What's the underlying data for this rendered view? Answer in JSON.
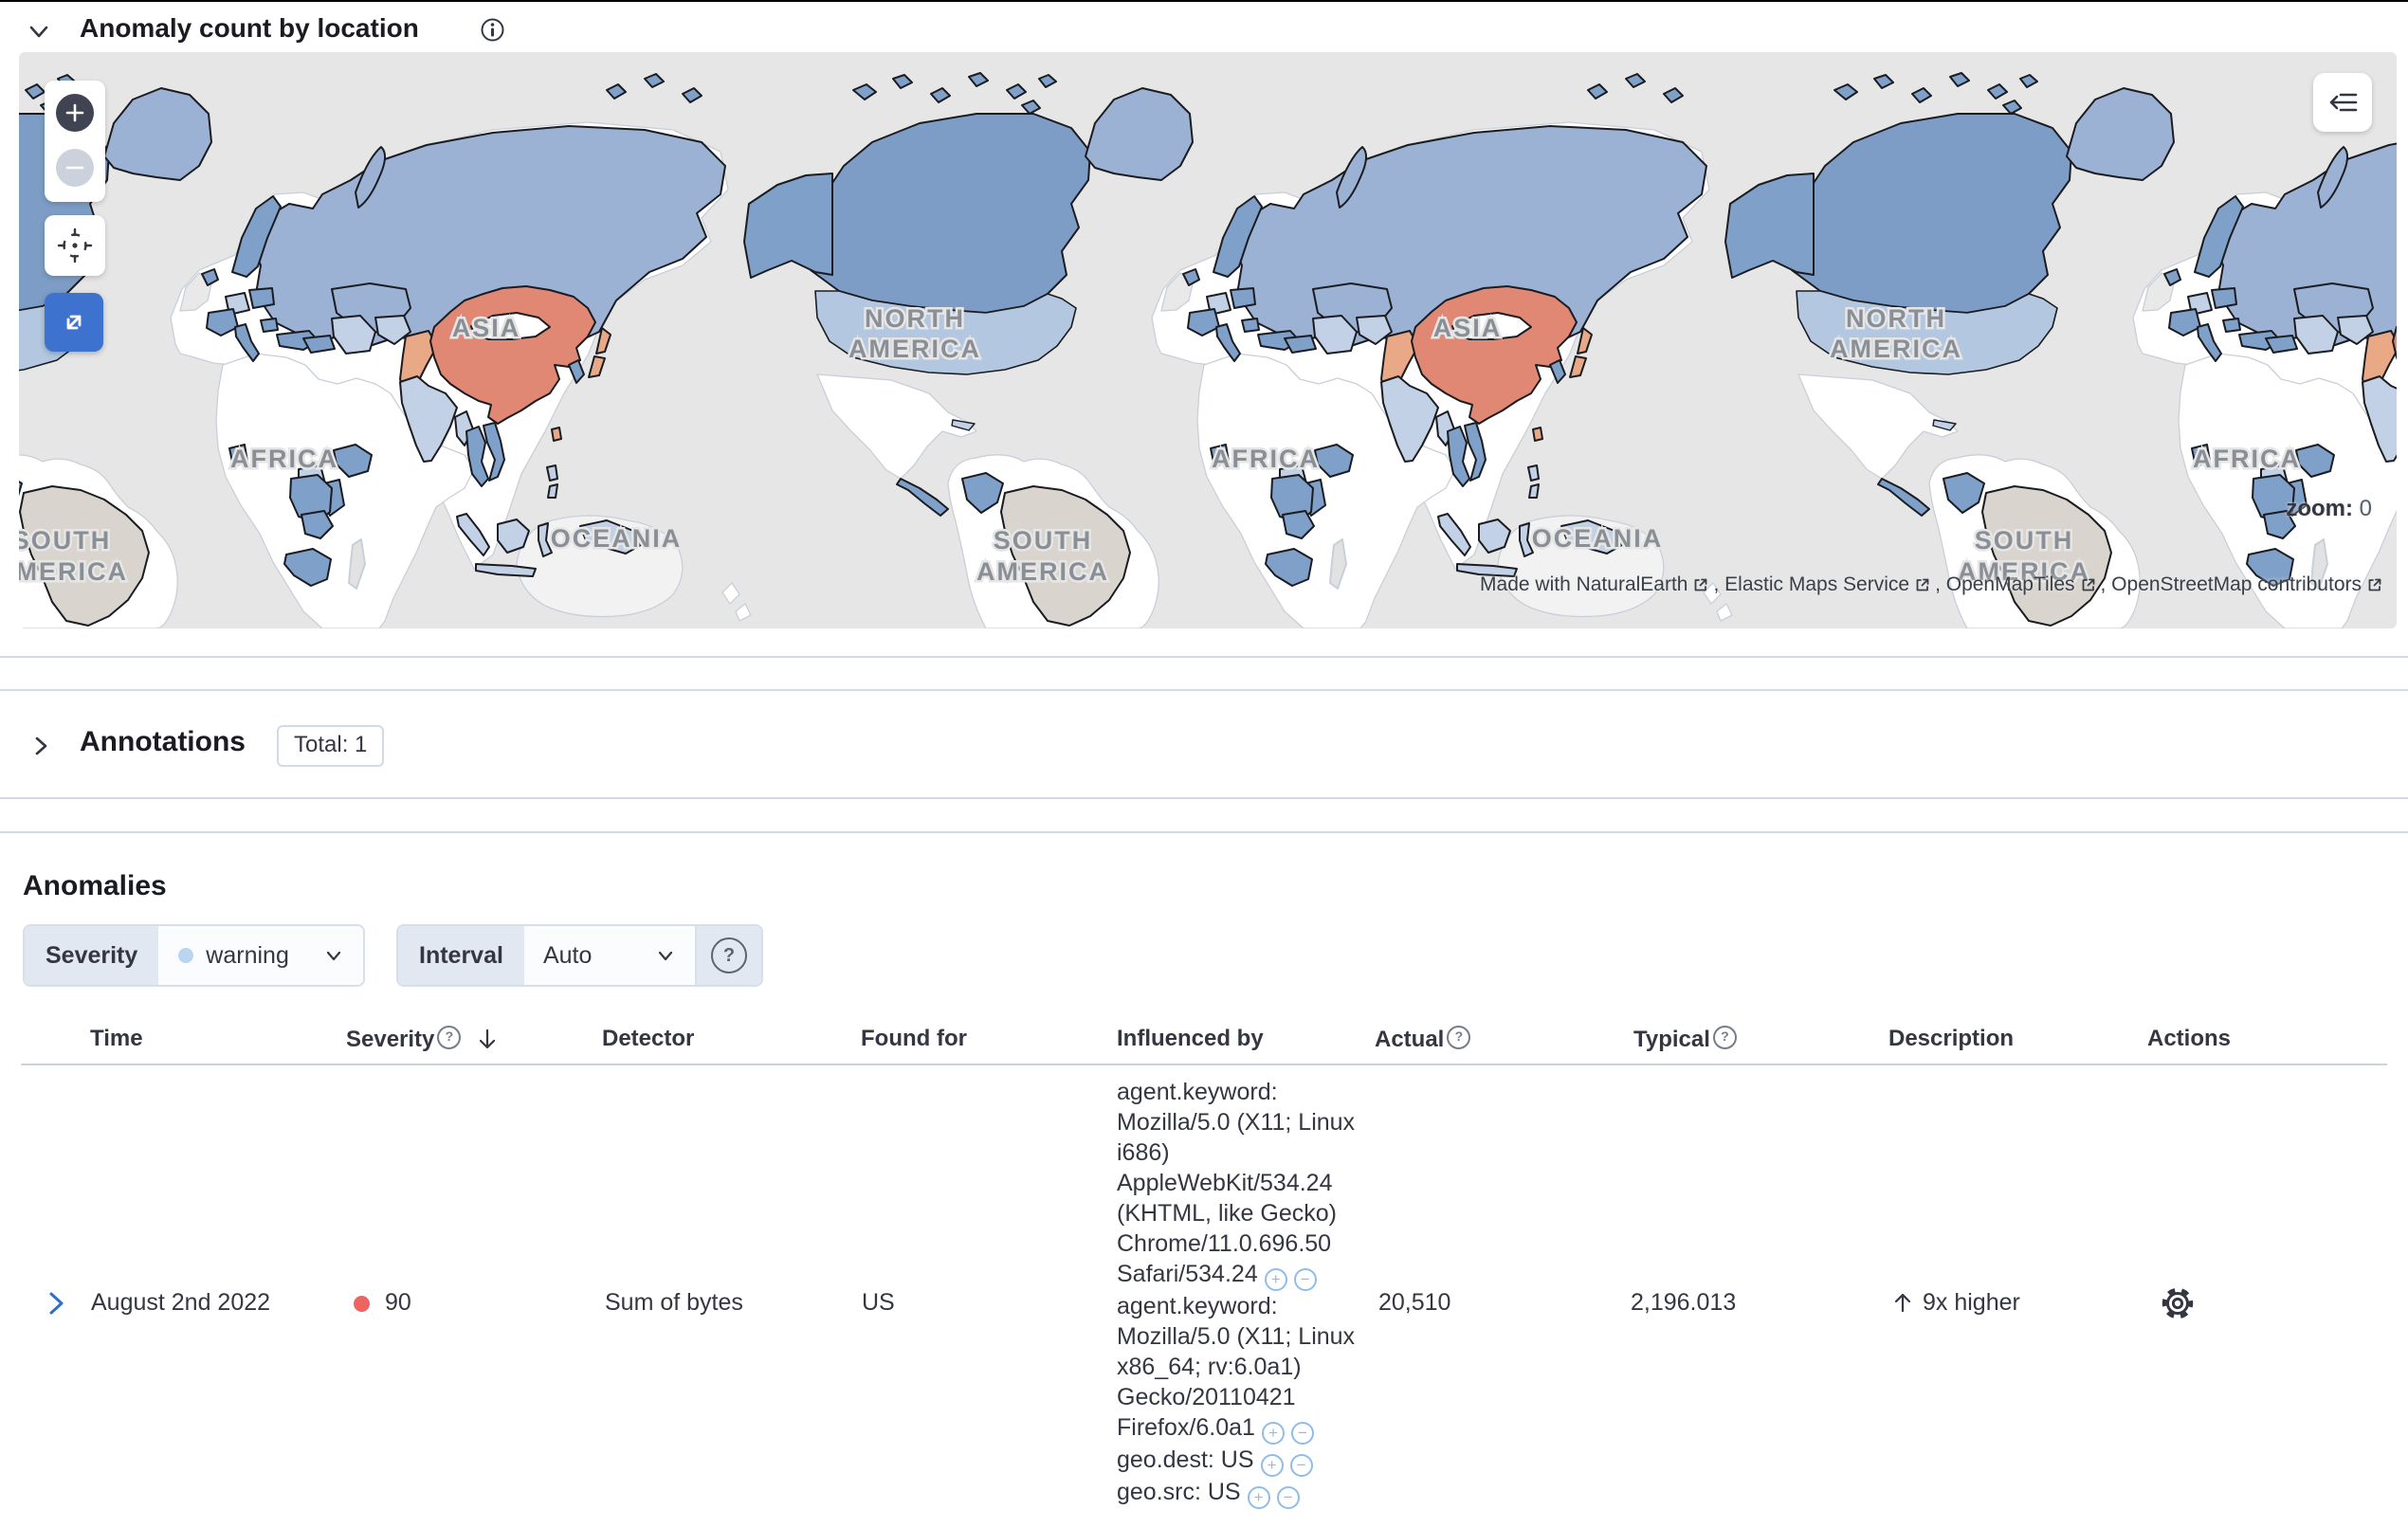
{
  "map_section": {
    "title": "Anomaly count by location",
    "zoom_indicator": {
      "label": "zoom:",
      "value": "0"
    },
    "attribution": [
      "Made with NaturalEarth",
      "Elastic Maps Service",
      "OpenMapTiles",
      "OpenStreetMap contributors"
    ],
    "labels": {
      "asia": "ASIA",
      "north": "NORTH",
      "america": "AMERICA",
      "africa": "AFRICA",
      "oceania": "OCEANIA",
      "south": "SOUTH"
    },
    "colors": {
      "ocean": "#E6E6E6",
      "land": "#FFFFFF",
      "land_border": "#C9CFD8",
      "country_border": "#1A1C21",
      "anomaly_high": "#E08873",
      "anomaly_mid": "#E9A886",
      "blue_strong": "#7FA0C8",
      "blue_mid": "#9CB2D4",
      "blue_light": "#C2D1E6",
      "blue_us": "#B3C8E0",
      "canada_blue": "#7D9DC6",
      "no_data_tan": "#D9D4CE",
      "primary_button": "#3D73CE",
      "light_gray_land": "#E2E2E2"
    }
  },
  "annotations_section": {
    "title": "Annotations",
    "badge": "Total: 1"
  },
  "anomalies_section": {
    "title": "Anomalies",
    "filters": {
      "severity": {
        "label": "Severity",
        "value": "warning",
        "dot_color": "#BBD4F0"
      },
      "interval": {
        "label": "Interval",
        "value": "Auto",
        "help": "?"
      }
    },
    "table": {
      "columns": {
        "time": "Time",
        "severity": "Severity",
        "detector": "Detector",
        "found_for": "Found for",
        "influenced_by": "Influenced by",
        "actual": "Actual",
        "typical": "Typical",
        "description": "Description",
        "actions": "Actions"
      },
      "row": {
        "time": "August 2nd 2022",
        "severity_score": "90",
        "severity_color": "#EF6460",
        "detector": "Sum of bytes",
        "found_for": "US",
        "influenced_by": [
          "agent.keyword: Mozilla/5.0 (X11; Linux i686) AppleWebKit/534.24 (KHTML, like Gecko) Chrome/11.0.696.50 Safari/534.24",
          "agent.keyword: Mozilla/5.0 (X11; Linux x86_64; rv:6.0a1) Gecko/20110421 Firefox/6.0a1",
          "geo.dest: US",
          "geo.src: US"
        ],
        "actual": "20,510",
        "typical": "2,196.013",
        "description": "9x higher"
      }
    }
  }
}
